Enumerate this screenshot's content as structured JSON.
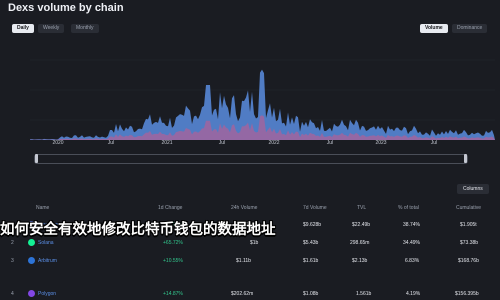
{
  "header": {
    "title": "Dexs volume by chain",
    "date_range": "Daily Weekly Monthly",
    "period_tabs": [
      "Daily",
      "Weekly",
      "Monthly"
    ],
    "active_period": "Daily",
    "metric_tabs": [
      "Volume",
      "Dominance"
    ],
    "active_metric": "Volume"
  },
  "chart": {
    "x_ticks": [
      "2020",
      "Jul",
      "2021",
      "Jul",
      "2022",
      "Jul",
      "2023",
      "Jul"
    ],
    "fill_color": "#5a8de0"
  },
  "columns_select": "Columns",
  "table": {
    "headers": [
      "Name",
      "1d Change",
      "24h Volume",
      "7d Volume",
      "TVL",
      "% of total",
      "Cumulative"
    ],
    "rows": [
      {
        "rank": "1",
        "name": "Ethereum",
        "change": "+21.62%",
        "vol24": "$1.434b",
        "vol7d": "$9.628b",
        "tvl": "$22.49b",
        "pct": "38.74%",
        "cum": "$1.905t",
        "color": "#627eea"
      },
      {
        "rank": "2",
        "name": "Solana",
        "change": "+65.72%",
        "vol24": "$1b",
        "vol7d": "$5.43b",
        "tvl": "298.65m",
        "pct": "34.49%",
        "cum": "$73.38b",
        "color": "#14f195"
      },
      {
        "rank": "3",
        "name": "Arbitrum",
        "change": "+10.55%",
        "vol24": "$1.11b",
        "vol7d": "$1.61b",
        "tvl": "$2.13b",
        "pct": "6.83%",
        "cum": "$168.76b",
        "color": "#2d74d8"
      },
      {
        "rank": "4",
        "name": "Polygon",
        "change": "+14.87%",
        "vol24": "$202.62m",
        "vol7d": "$1.08b",
        "tvl": "1.561b",
        "pct": "4.19%",
        "cum": "$156.395b",
        "color": "#8247e5"
      }
    ]
  },
  "overlay_text": "如何安全有效地修改比特币钱包的数据地址"
}
